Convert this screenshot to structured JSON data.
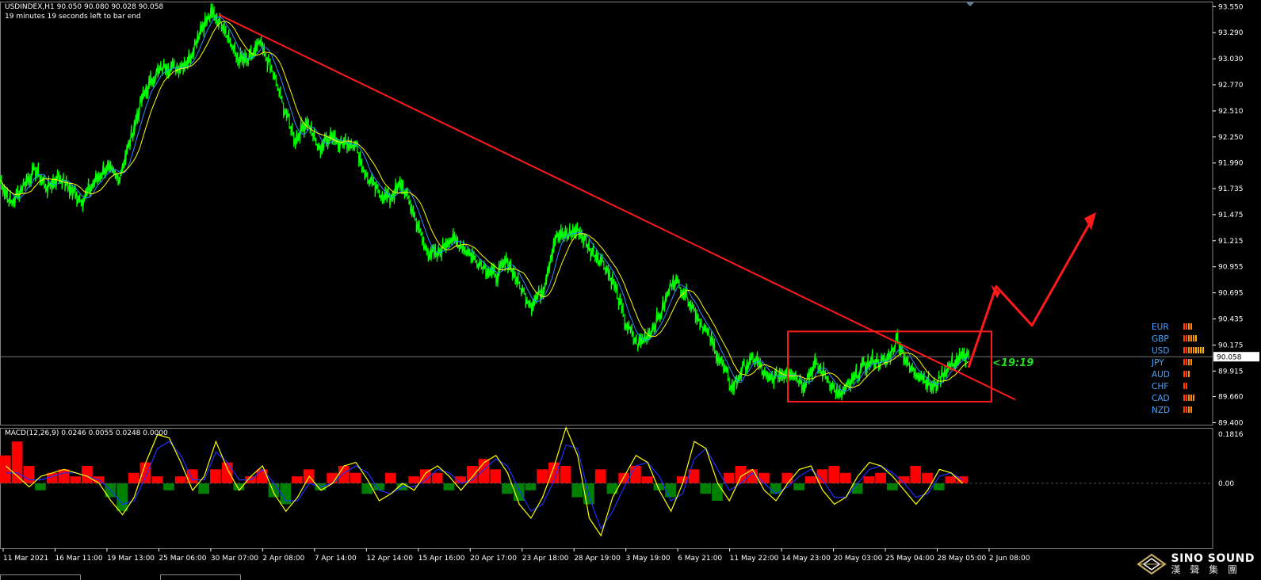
{
  "header": {
    "symbol_line": "USDINDEX,H1  90.050 90.080 90.028 90.058",
    "timer_line": "19 minutes 19 seconds left to bar end"
  },
  "macd_label": "MACD(12,26,9) 0.0246 0.0055 0.0248 0.0000",
  "timer_annotation": "<19:19",
  "brand": {
    "name": "SINO SOUND",
    "sub": "漢 聲 集 團"
  },
  "colors": {
    "price": "#00ff00",
    "ma_fast": "#2f8bff",
    "ma_slow": "#ffff00",
    "trendline": "#ff1a1a",
    "macd_pos": "#ff0000",
    "macd_neg": "#008000",
    "signal_yellow": "#ffff00",
    "signal_blue": "#1f2fff"
  },
  "currency_strength": [
    {
      "name": "EUR",
      "bars": 4
    },
    {
      "name": "GBP",
      "bars": 6
    },
    {
      "name": "USD",
      "bars": 9
    },
    {
      "name": "JPY",
      "bars": 4
    },
    {
      "name": "AUD",
      "bars": 3
    },
    {
      "name": "CHF",
      "bars": 2
    },
    {
      "name": "CAD",
      "bars": 5
    },
    {
      "name": "NZD",
      "bars": 4
    }
  ],
  "chart_data": {
    "type": "line",
    "title": "USDINDEX,H1",
    "current_price": 90.058,
    "y_ticks": [
      93.55,
      93.29,
      93.03,
      92.77,
      92.51,
      92.25,
      91.99,
      91.735,
      91.475,
      91.215,
      90.955,
      90.695,
      90.435,
      90.175,
      89.915,
      89.66,
      89.4
    ],
    "y_tick_labels": [
      "93.550",
      "93.290",
      "93.030",
      "92.770",
      "92.510",
      "92.250",
      "91.990",
      "91.735",
      "91.475",
      "91.215",
      "90.955",
      "90.695",
      "90.435",
      "90.175",
      "89.915",
      "89.660",
      "89.400"
    ],
    "ylim": [
      89.38,
      93.6
    ],
    "x_labels": [
      "11 Mar 2021",
      "16 Mar 11:00",
      "19 Mar 13:00",
      "25 Mar 06:00",
      "30 Mar 07:00",
      "2 Apr 08:00",
      "7 Apr 14:00",
      "12 Apr 14:00",
      "15 Apr 16:00",
      "20 Apr 17:00",
      "23 Apr 18:00",
      "28 Apr 19:00",
      "3 May 19:00",
      "6 May 21:00",
      "11 May 22:00",
      "14 May 23:00",
      "20 May 03:00",
      "25 May 04:00",
      "28 May 05:00",
      "2 Jun 08:00"
    ],
    "series": [
      {
        "name": "price",
        "values": [
          91.82,
          91.58,
          91.78,
          91.92,
          91.74,
          91.86,
          91.72,
          91.62,
          91.8,
          91.95,
          91.82,
          92.2,
          92.62,
          92.85,
          92.96,
          92.94,
          93.02,
          93.34,
          93.48,
          93.36,
          93.04,
          93.0,
          93.18,
          92.92,
          92.56,
          92.22,
          92.42,
          92.12,
          92.28,
          92.18,
          92.2,
          91.86,
          91.7,
          91.64,
          91.78,
          91.5,
          91.14,
          91.06,
          91.24,
          91.18,
          91.06,
          90.96,
          90.86,
          91.02,
          90.76,
          90.58,
          90.74,
          91.24,
          91.28,
          91.32,
          91.12,
          91.02,
          90.78,
          90.38,
          90.18,
          90.3,
          90.5,
          90.84,
          90.7,
          90.48,
          90.26,
          90.02,
          89.74,
          89.96,
          90.04,
          89.82,
          89.88,
          89.92,
          89.78,
          89.98,
          89.86,
          89.66,
          89.78,
          89.95,
          90.02,
          90.0,
          90.24,
          89.94,
          89.88,
          89.74,
          89.92,
          90.02,
          90.08
        ]
      },
      {
        "name": "ma_fast",
        "values": []
      },
      {
        "name": "ma_slow",
        "values": []
      }
    ],
    "macd": {
      "zero_label": "0.00",
      "top_label": "0.1816",
      "ylim": [
        -0.2,
        0.1816
      ],
      "histogram": [
        0.08,
        0.12,
        0.05,
        -0.02,
        0.03,
        0.04,
        0.02,
        0.05,
        0.02,
        -0.04,
        -0.08,
        0.03,
        0.06,
        0.02,
        -0.02,
        0.02,
        0.04,
        -0.03,
        0.04,
        0.06,
        -0.02,
        0.02,
        0.04,
        -0.04,
        -0.06,
        0.02,
        0.04,
        -0.02,
        0.03,
        0.05,
        0.03,
        -0.03,
        -0.02,
        0.03,
        -0.02,
        0.02,
        0.04,
        0.03,
        -0.02,
        0.02,
        0.05,
        0.07,
        0.04,
        -0.03,
        -0.05,
        -0.02,
        0.04,
        0.06,
        0.05,
        -0.04,
        -0.06,
        0.04,
        -0.03,
        0.03,
        0.05,
        0.02,
        -0.02,
        -0.04,
        0.02,
        0.04,
        -0.03,
        -0.05,
        0.03,
        0.05,
        0.04,
        0.03,
        -0.03,
        0.03,
        -0.02,
        0.02,
        0.04,
        0.05,
        0.03,
        -0.03,
        0.02,
        0.03,
        -0.02,
        0.02,
        0.05,
        0.03,
        -0.02,
        0.02,
        0.02
      ],
      "signal_yellow": [
        0.05,
        0.02,
        -0.01,
        0.02,
        0.03,
        0.04,
        0.03,
        0.02,
        0.0,
        -0.05,
        -0.09,
        -0.04,
        0.06,
        0.14,
        0.13,
        0.06,
        -0.02,
        0.02,
        0.12,
        0.04,
        -0.02,
        0.02,
        0.05,
        -0.03,
        -0.08,
        -0.04,
        0.02,
        -0.02,
        0.0,
        0.05,
        0.06,
        0.01,
        -0.05,
        -0.03,
        0.0,
        -0.02,
        0.03,
        0.05,
        0.02,
        -0.02,
        0.02,
        0.06,
        0.08,
        0.03,
        -0.06,
        -0.1,
        -0.04,
        0.05,
        0.16,
        0.08,
        -0.1,
        -0.15,
        -0.04,
        0.02,
        0.08,
        0.06,
        -0.02,
        -0.08,
        0.0,
        0.12,
        0.1,
        0.0,
        -0.05,
        0.02,
        0.04,
        -0.02,
        -0.05,
        0.0,
        0.04,
        0.05,
        -0.02,
        -0.06,
        -0.04,
        0.02,
        0.06,
        0.05,
        0.02,
        -0.02,
        -0.06,
        -0.02,
        0.04,
        0.03,
        0.0
      ],
      "signal_blue": [
        0.03,
        0.03,
        0.01,
        0.01,
        0.02,
        0.03,
        0.03,
        0.02,
        0.01,
        -0.02,
        -0.06,
        -0.05,
        0.02,
        0.1,
        0.12,
        0.08,
        0.01,
        0.01,
        0.09,
        0.06,
        0.01,
        0.01,
        0.04,
        0.0,
        -0.05,
        -0.05,
        0.0,
        -0.01,
        0.0,
        0.03,
        0.05,
        0.03,
        -0.02,
        -0.03,
        -0.01,
        -0.01,
        0.01,
        0.04,
        0.03,
        0.0,
        0.01,
        0.04,
        0.07,
        0.05,
        -0.02,
        -0.08,
        -0.06,
        0.01,
        0.11,
        0.1,
        -0.04,
        -0.13,
        -0.08,
        -0.01,
        0.05,
        0.06,
        0.02,
        -0.05,
        -0.03,
        0.07,
        0.1,
        0.04,
        -0.02,
        0.0,
        0.03,
        0.0,
        -0.03,
        -0.01,
        0.02,
        0.04,
        0.01,
        -0.04,
        -0.04,
        0.0,
        0.04,
        0.05,
        0.03,
        0.0,
        -0.04,
        -0.03,
        0.02,
        0.03,
        0.01
      ]
    },
    "grid": false,
    "legend": "none"
  }
}
